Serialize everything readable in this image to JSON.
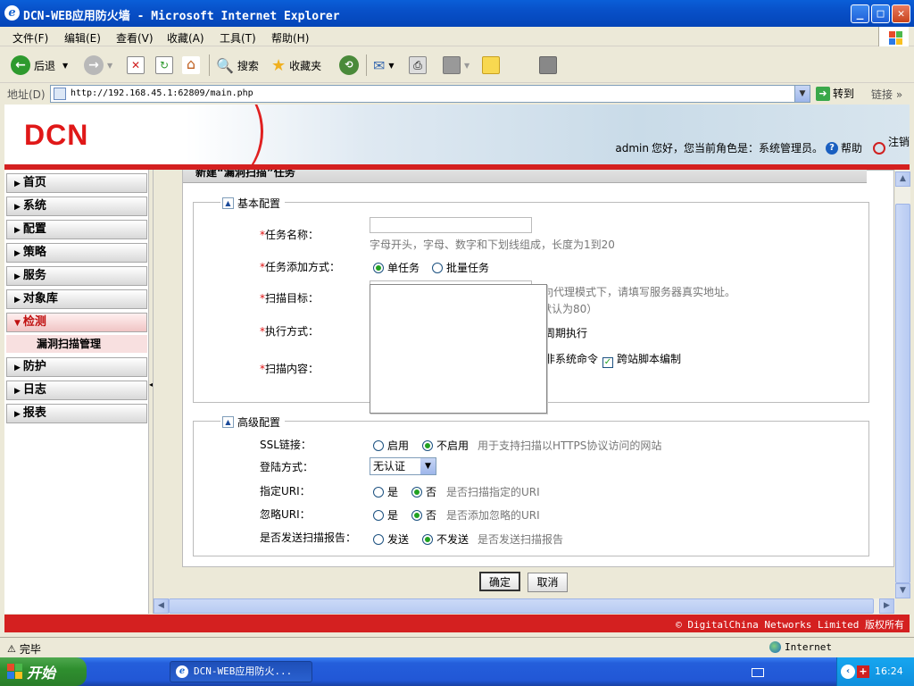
{
  "window": {
    "title": "DCN-WEB应用防火墙 - Microsoft Internet Explorer",
    "minimize": "_",
    "maximize": "□",
    "close": "✕"
  },
  "menu": [
    "文件(F)",
    "编辑(E)",
    "查看(V)",
    "收藏(A)",
    "工具(T)",
    "帮助(H)"
  ],
  "toolbar": {
    "back": "后退",
    "search": "搜索",
    "favorites": "收藏夹"
  },
  "address": {
    "label": "地址(D)",
    "url": "http://192.168.45.1:62809/main.php",
    "go": "转到",
    "links": "链接"
  },
  "header": {
    "logo": "DCN",
    "user": "admin",
    "greeting": "您好，您当前角色是：系统管理员。",
    "help": "帮助",
    "logout": "注销"
  },
  "sidebar": {
    "items": [
      {
        "label": "首页"
      },
      {
        "label": "系统"
      },
      {
        "label": "配置"
      },
      {
        "label": "策略"
      },
      {
        "label": "服务"
      },
      {
        "label": "对象库"
      },
      {
        "label": "检测"
      },
      {
        "label": "防护"
      },
      {
        "label": "日志"
      },
      {
        "label": "报表"
      }
    ],
    "sub_item": "漏洞扫描管理"
  },
  "panel": {
    "title": "新建“漏洞扫描”任务",
    "basic": {
      "legend": "基本配置",
      "task_name_label": "任务名称：",
      "task_name_hint": "字母开头，字母、数字和下划线组成，长度为1到20",
      "add_mode_label": "任务添加方式：",
      "add_mode_single": "单任务",
      "add_mode_batch": "批量任务",
      "target_label": "扫描目标：",
      "target_hint1": "反向代理模式下，请填写服务器真实地址。",
      "target_hint2": "默认为80）",
      "exec_label": "执行方式：",
      "exec_periodic": "周期执行",
      "content_label": "扫描内容：",
      "content_cmd": "非系统命令",
      "content_xss": "跨站脚本编制"
    },
    "advanced": {
      "legend": "高级配置",
      "ssl_label": "SSL链接：",
      "ssl_on": "启用",
      "ssl_off": "不启用",
      "ssl_hint": "用于支持扫描以HTTPS协议访问的网站",
      "login_label": "登陆方式：",
      "login_value": "无认证",
      "uri_label": "指定URI：",
      "uri_yes": "是",
      "uri_no": "否",
      "uri_hint": "是否扫描指定的URI",
      "ignore_label": "忽略URI：",
      "ignore_yes": "是",
      "ignore_no": "否",
      "ignore_hint": "是否添加忽略的URI",
      "report_label": "是否发送扫描报告：",
      "report_send": "发送",
      "report_nosend": "不发送",
      "report_hint": "是否发送扫描报告"
    },
    "ok": "确定",
    "cancel": "取消"
  },
  "footer": {
    "copyright": "© DigitalChina Networks Limited 版权所有"
  },
  "status": {
    "text": "完毕",
    "zone": "Internet"
  },
  "taskbar": {
    "start": "开始",
    "task": "DCN-WEB应用防火...",
    "clock": "16:24"
  },
  "colors": {
    "brand_red": "#d42020",
    "xp_blue": "#245edb",
    "radio_green": "#21a121"
  }
}
